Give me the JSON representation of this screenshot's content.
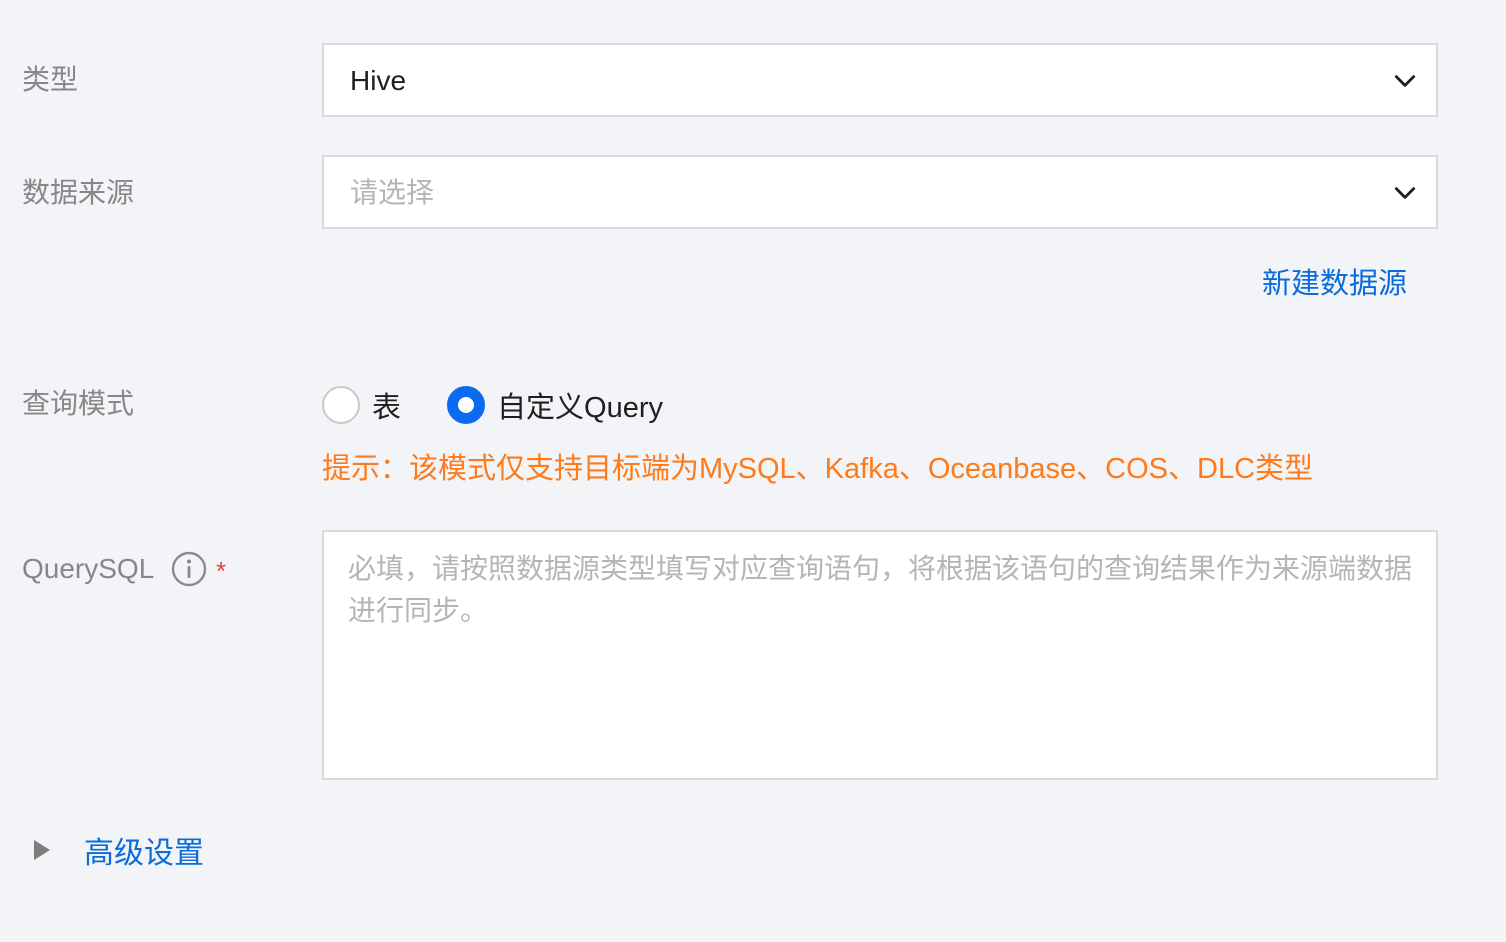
{
  "form": {
    "type_label": "类型",
    "type_value": "Hive",
    "source_label": "数据来源",
    "source_placeholder": "请选择",
    "new_source_link": "新建数据源",
    "query_mode_label": "查询模式",
    "query_mode_options": [
      {
        "label": "表",
        "checked": false
      },
      {
        "label": "自定义Query",
        "checked": true
      }
    ],
    "hint": "提示：该模式仅支持目标端为MySQL、Kafka、Oceanbase、COS、DLC类型",
    "querysql_label": "QuerySQL",
    "querysql_required_mark": "*",
    "querysql_placeholder": "必填，请按照数据源类型填写对应查询语句，将根据该语句的查询结果作为来源端数据进行同步。",
    "advanced_settings": "高级设置"
  },
  "icons": {
    "dropdown": "chevron-down-icon",
    "info": "info-icon",
    "expand": "caret-right-icon"
  },
  "colors": {
    "background": "#f3f4f7",
    "link": "#0a6bdc",
    "radio_checked": "#0a6bf0",
    "hint": "#ff7a1a",
    "required": "#e54545"
  }
}
